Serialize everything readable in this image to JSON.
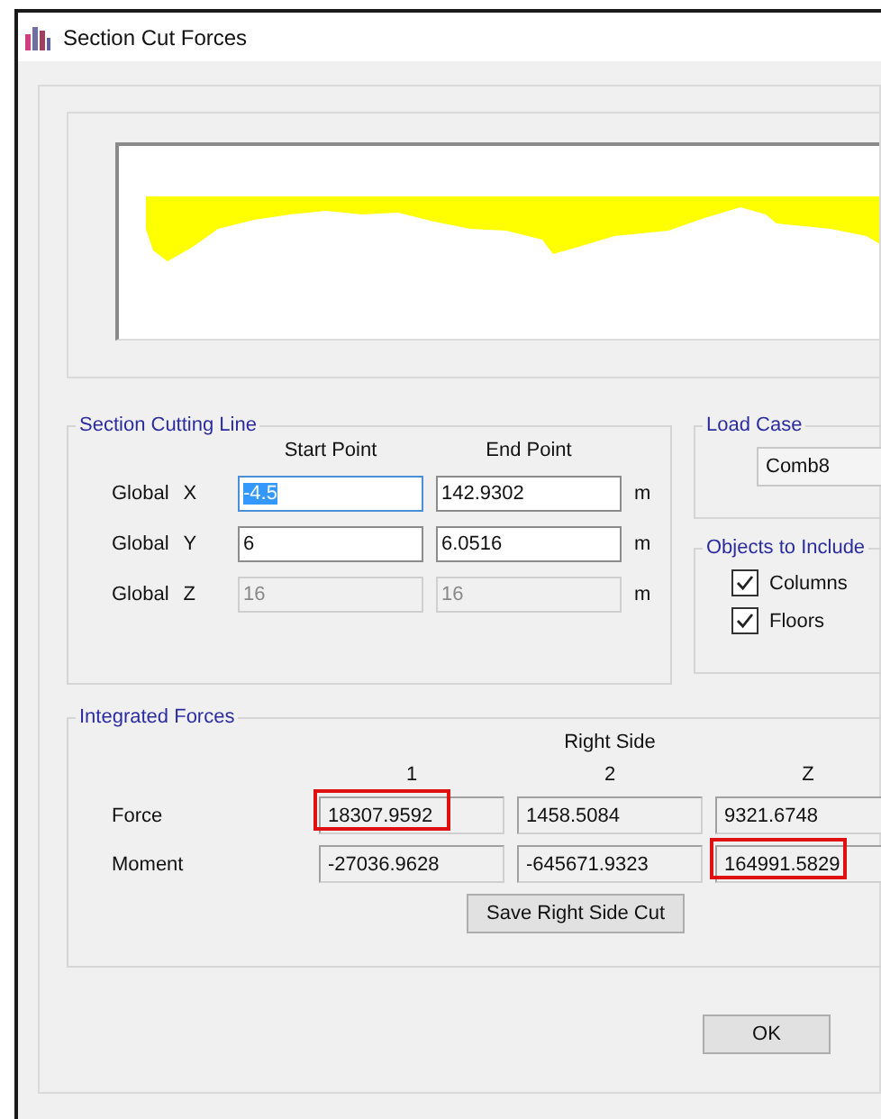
{
  "window": {
    "title": "Section Cut Forces"
  },
  "section_cutting_line": {
    "title": "Section Cutting Line",
    "columns": [
      "Start Point",
      "End Point"
    ],
    "rows": [
      {
        "label": "Global",
        "axis": "X",
        "start": "-4.5",
        "start_text_selected": true,
        "end": "142.9302",
        "unit": "m",
        "disabled": false
      },
      {
        "label": "Global",
        "axis": "Y",
        "start": "6",
        "start_text_selected": false,
        "end": "6.0516",
        "unit": "m",
        "disabled": false
      },
      {
        "label": "Global",
        "axis": "Z",
        "start": "16",
        "start_text_selected": false,
        "end": "16",
        "unit": "m",
        "disabled": true
      }
    ]
  },
  "load_case": {
    "title": "Load Case",
    "value": "Comb8"
  },
  "objects_to_include": {
    "title": "Objects to Include",
    "items": [
      {
        "label": "Columns",
        "checked": true
      },
      {
        "label": "Floors",
        "checked": true
      }
    ]
  },
  "integrated_forces": {
    "title": "Integrated Forces",
    "heading": "Right Side",
    "columns": [
      "1",
      "2",
      "Z"
    ],
    "rows": [
      {
        "label": "Force",
        "values": [
          {
            "value": "18307.9592",
            "highlighted": true
          },
          {
            "value": "1458.5084",
            "highlighted": false
          },
          {
            "value": "9321.6748",
            "highlighted": false
          }
        ]
      },
      {
        "label": "Moment",
        "values": [
          {
            "value": "-27036.9628",
            "highlighted": false
          },
          {
            "value": "-645671.9323",
            "highlighted": false
          },
          {
            "value": "164991.5829",
            "highlighted": true
          }
        ]
      }
    ],
    "save_button": "Save Right Side Cut"
  },
  "buttons": [
    {
      "label": "OK"
    }
  ]
}
